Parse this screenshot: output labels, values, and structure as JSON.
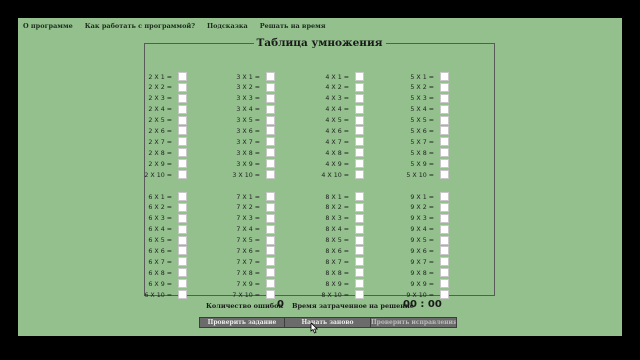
{
  "menu": [
    {
      "label": "О программе"
    },
    {
      "label": "Как работать с программой?"
    },
    {
      "label": "Подсказка"
    },
    {
      "label": "Решать на время"
    }
  ],
  "table": {
    "title": "Таблица умножения",
    "blocks": [
      {
        "base": 2,
        "rows": [
          "2 X 1 =",
          "2 X 2 =",
          "2 X 3 =",
          "2 X 4 =",
          "2 X 5 =",
          "2 X 6 =",
          "2 X 7 =",
          "2 X 8 =",
          "2 X 9 =",
          "2 X 10 ="
        ]
      },
      {
        "base": 3,
        "rows": [
          "3 X 1 =",
          "3 X 2 =",
          "3 X 3 =",
          "3 X 4 =",
          "3 X 5 =",
          "3 X 6 =",
          "3 X 7 =",
          "3 X 8 =",
          "3 X 9 =",
          "3 X 10 ="
        ]
      },
      {
        "base": 4,
        "rows": [
          "4 X 1 =",
          "4 X 2 =",
          "4 X 3 =",
          "4 X 4 =",
          "4 X 5 =",
          "4 X 6 =",
          "4 X 7 =",
          "4 X 8 =",
          "4 X 9 =",
          "4 X 10 ="
        ]
      },
      {
        "base": 5,
        "rows": [
          "5 X 1 =",
          "5 X 2 =",
          "5 X 3 =",
          "5 X 4 =",
          "5 X 5 =",
          "5 X 6 =",
          "5 X 7 =",
          "5 X 8 =",
          "5 X 9 =",
          "5 X 10 ="
        ]
      },
      {
        "base": 6,
        "rows": [
          "6 X 1 =",
          "6 X 2 =",
          "6 X 3 =",
          "6 X 4 =",
          "6 X 5 =",
          "6 X 6 =",
          "6 X 7 =",
          "6 X 8 =",
          "6 X 9 =",
          "6 X 10 ="
        ]
      },
      {
        "base": 7,
        "rows": [
          "7 X 1 =",
          "7 X 2 =",
          "7 X 3 =",
          "7 X 4 =",
          "7 X 5 =",
          "7 X 6 =",
          "7 X 7 =",
          "7 X 8 =",
          "7 X 9 =",
          "7 X 10 ="
        ]
      },
      {
        "base": 8,
        "rows": [
          "8 X 1 =",
          "8 X 2 =",
          "8 X 3 =",
          "8 X 4 =",
          "8 X 5 =",
          "8 X 6 =",
          "8 X 7 =",
          "8 X 8 =",
          "8 X 9 =",
          "8 X 10 ="
        ]
      },
      {
        "base": 9,
        "rows": [
          "9 X 1 =",
          "9 X 2 =",
          "9 X 3 =",
          "9 X 4 =",
          "9 X 5 =",
          "9 X 6 =",
          "9 X 7 =",
          "9 X 8 =",
          "9 X 9 =",
          "9 X 10 ="
        ]
      }
    ]
  },
  "status": {
    "errors_label": "Количество ошибок",
    "errors_value": "0",
    "time_label": "Время затраченное на решение",
    "time_value": "00 : 00"
  },
  "buttons": [
    {
      "label": "Проверить задание",
      "state": "enabled"
    },
    {
      "label": "Начать заново",
      "state": "enabled"
    },
    {
      "label": "Проверить исправления",
      "state": "disabled"
    }
  ],
  "colors": {
    "background": "#93c08d",
    "frame": "#000000",
    "button": "#6b6b6b",
    "border": "#5a5a5a"
  }
}
